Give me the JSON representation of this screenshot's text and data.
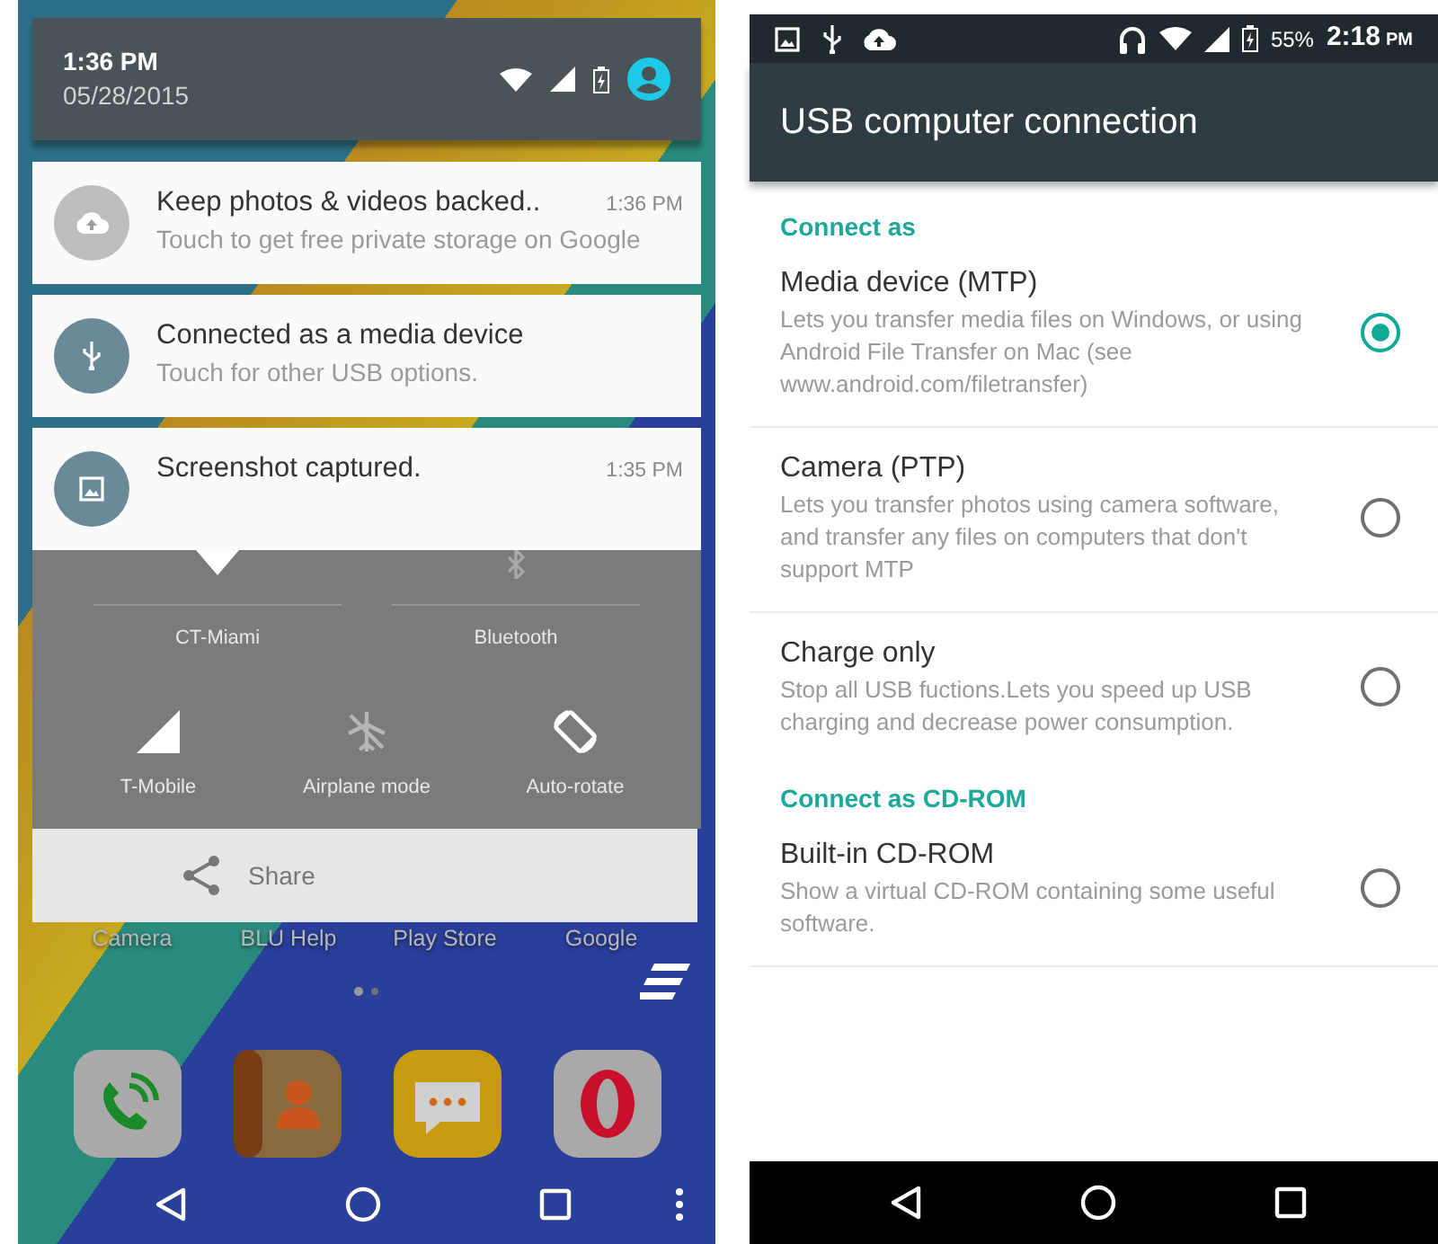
{
  "left_screen": {
    "header": {
      "time": "1:36 PM",
      "date": "05/28/2015"
    },
    "notifications": [
      {
        "kind": "cloud",
        "title": "Keep photos & videos backed..",
        "time": "1:36 PM",
        "text": "Touch to get free private storage on Google"
      },
      {
        "kind": "usb",
        "title": "Connected as a media device",
        "text": "Touch for other USB options."
      },
      {
        "kind": "image",
        "title": "Screenshot captured.",
        "time": "1:35 PM"
      }
    ],
    "quick_settings": [
      {
        "kind": "wifi",
        "label": "CT-Miami"
      },
      {
        "kind": "bluetooth",
        "label": "Bluetooth"
      },
      {
        "kind": "signal",
        "label": "T-Mobile"
      },
      {
        "kind": "airplane",
        "label": "Airplane mode"
      },
      {
        "kind": "rotate",
        "label": "Auto-rotate"
      }
    ],
    "share_button": {
      "label": "Share"
    },
    "home_apps": [
      {
        "label": "Camera"
      },
      {
        "label": "BLU Help"
      },
      {
        "label": "Play Store"
      },
      {
        "label": "Google"
      }
    ]
  },
  "right_screen": {
    "status_bar": {
      "battery": "55%",
      "time": "2:18",
      "time_suffix": "PM"
    },
    "title": "USB computer connection",
    "sections": [
      {
        "heading": "Connect as",
        "options": [
          {
            "title": "Media device (MTP)",
            "description": "Lets you transfer media files on Windows, or using Android File Transfer on Mac (see www.android.com/filetransfer)",
            "selected": true
          },
          {
            "title": "Camera (PTP)",
            "description": "Lets you transfer photos using camera software, and transfer any files on computers that don't support MTP",
            "selected": false
          },
          {
            "title": "Charge only",
            "description": "Stop all USB fuctions.Lets you speed up USB charging and decrease power consumption.",
            "selected": false
          }
        ]
      },
      {
        "heading": "Connect as CD-ROM",
        "options": [
          {
            "title": "Built-in CD-ROM",
            "description": "Show a virtual CD-ROM containing some useful software.",
            "selected": false
          }
        ]
      }
    ]
  }
}
